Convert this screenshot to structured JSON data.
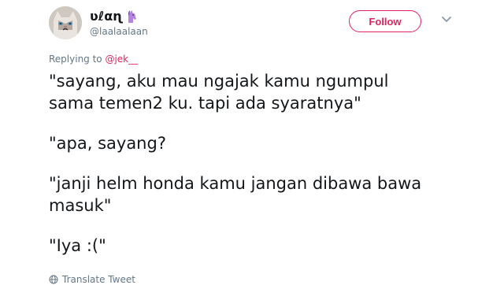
{
  "header": {
    "display_name": "ʋℓαɳ",
    "handle": "@laalaalaan",
    "follow_label": "Follow"
  },
  "reply": {
    "prefix": "Replying to ",
    "target": "@jek__"
  },
  "tweet": {
    "paragraphs": [
      "\"sayang, aku mau ngajak kamu ngumpul\nsama temen2 ku. tapi ada syaratnya\"",
      "\"apa, sayang?",
      "\"janji helm honda kamu jangan dibawa bawa\nmasuk\"",
      "\"Iya :(\""
    ]
  },
  "footer": {
    "translate_label": "Translate Tweet"
  },
  "colors": {
    "accent": "#e0245e",
    "secondary_text": "#657786",
    "text": "#14171a"
  },
  "icons": {
    "name_emoji": "unicorn-icon",
    "menu": "chevron-down-icon",
    "translate": "globe-icon"
  }
}
